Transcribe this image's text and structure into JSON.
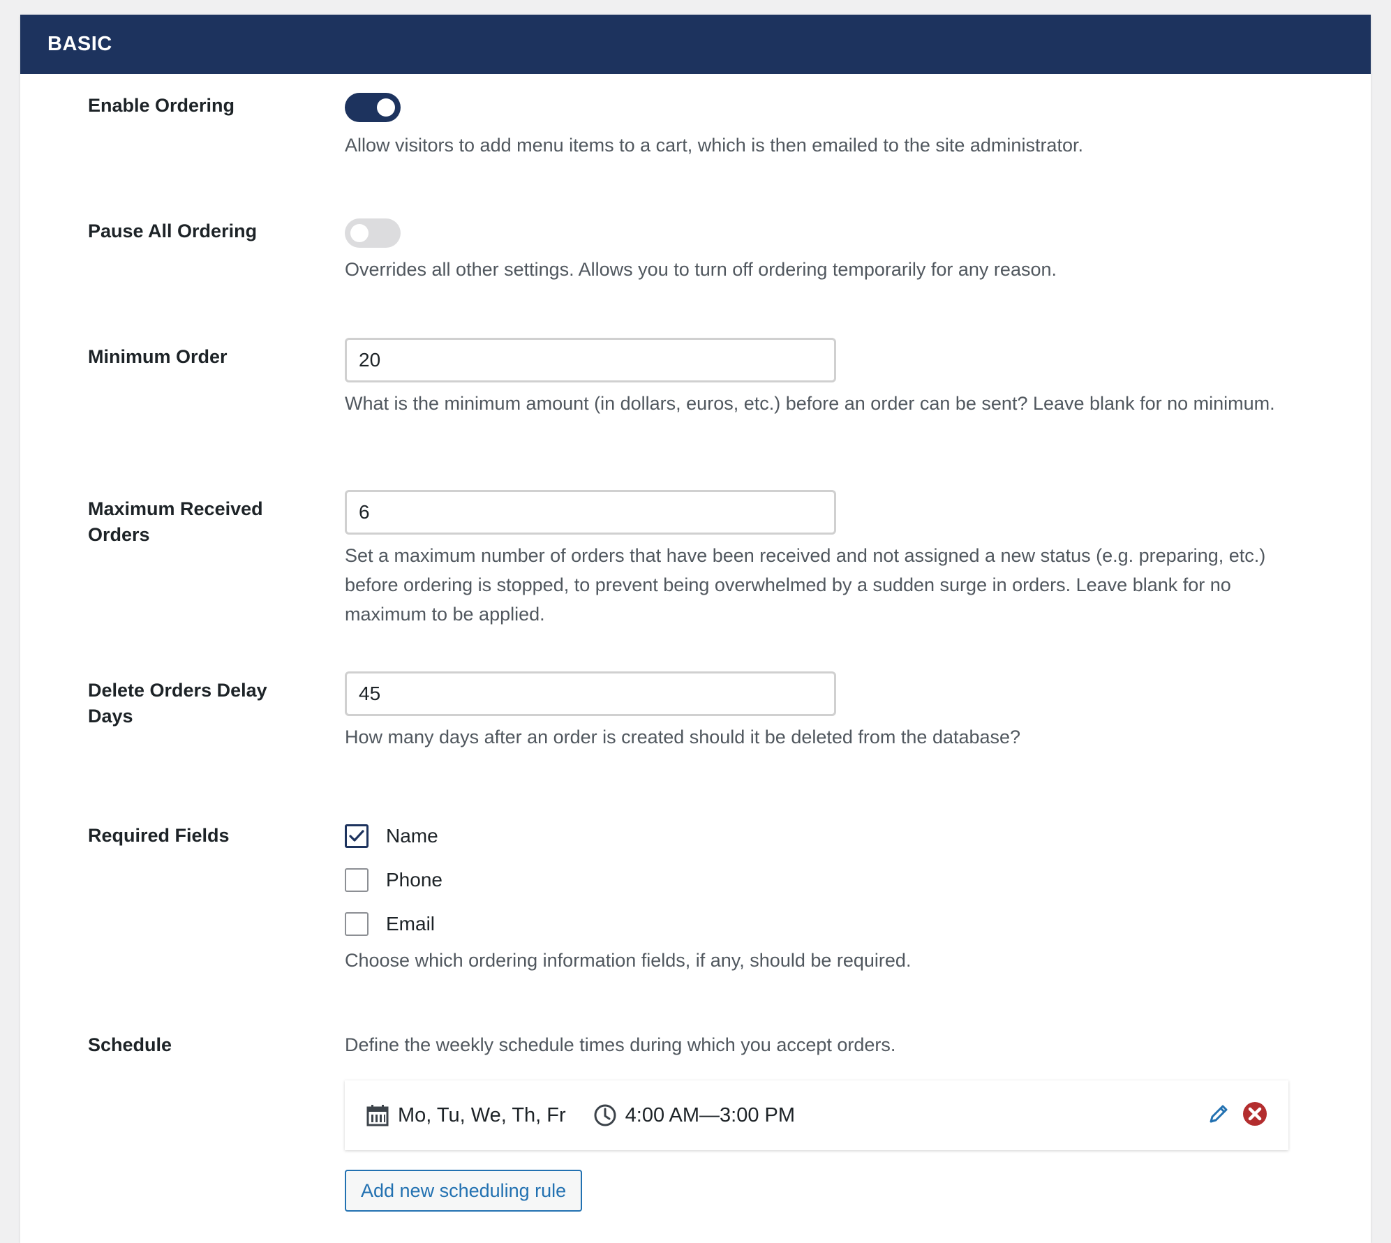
{
  "section": {
    "title": "BASIC"
  },
  "settings": {
    "enable_ordering": {
      "label": "Enable Ordering",
      "enabled": true,
      "description": "Allow visitors to add menu items to a cart, which is then emailed to the site administrator."
    },
    "pause_all_ordering": {
      "label": "Pause All Ordering",
      "enabled": false,
      "description": "Overrides all other settings. Allows you to turn off ordering temporarily for any reason."
    },
    "minimum_order": {
      "label": "Minimum Order",
      "value": "20",
      "description": "What is the minimum amount (in dollars, euros, etc.) before an order can be sent? Leave blank for no minimum."
    },
    "maximum_received_orders": {
      "label": "Maximum Received Orders",
      "value": "6",
      "description": "Set a maximum number of orders that have been received and not assigned a new status (e.g. preparing, etc.) before ordering is stopped, to prevent being overwhelmed by a sudden surge in orders. Leave blank for no maximum to be applied."
    },
    "delete_orders_delay_days": {
      "label": "Delete Orders Delay Days",
      "value": "45",
      "description": "How many days after an order is created should it be deleted from the database?"
    },
    "required_fields": {
      "label": "Required Fields",
      "options": [
        {
          "label": "Name",
          "checked": true
        },
        {
          "label": "Phone",
          "checked": false
        },
        {
          "label": "Email",
          "checked": false
        }
      ],
      "description": "Choose which ordering information fields, if any, should be required."
    },
    "schedule": {
      "label": "Schedule",
      "description": "Define the weekly schedule times during which you accept orders.",
      "rules": [
        {
          "days": "Mo, Tu, We, Th, Fr",
          "time": "4:00 AM—3:00 PM",
          "days_icon": "calendar-icon",
          "time_icon": "clock-icon",
          "edit_icon": "pencil-icon",
          "delete_icon": "delete-circle-icon"
        }
      ],
      "add_button_label": "Add new scheduling rule"
    }
  },
  "colors": {
    "header_bg": "#1d335e",
    "toggle_on": "#1d335e",
    "toggle_off": "#dcdcde",
    "link_blue": "#2271b1",
    "delete_red": "#b32d2e"
  }
}
